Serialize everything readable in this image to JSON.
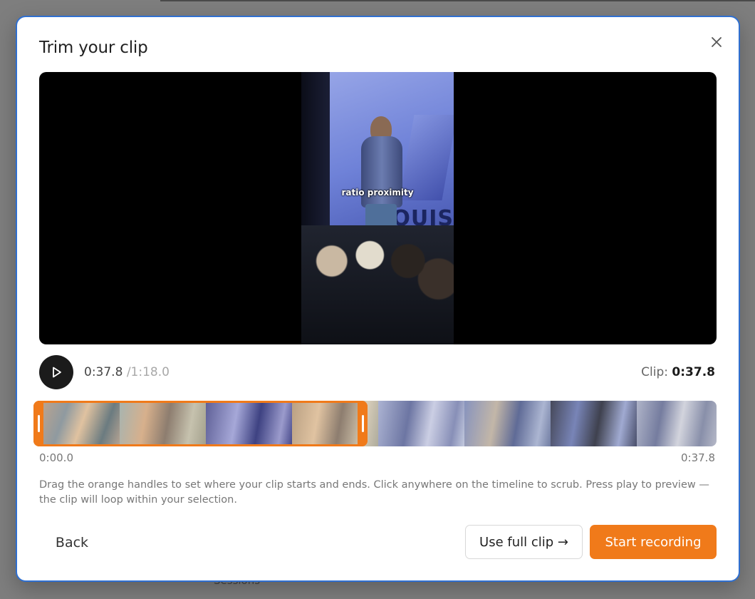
{
  "backdrop": {
    "footer_text": "Sessions"
  },
  "modal": {
    "title": "Trim your clip",
    "close_icon": "close-icon"
  },
  "video": {
    "caption": "ratio proximity",
    "banner_text": "QUIS"
  },
  "player": {
    "current_time": "0:37.8",
    "separator": "/",
    "duration": "1:18.0",
    "clip_label": "Clip:",
    "clip_length": "0:37.8",
    "play_icon": "play-icon"
  },
  "timeline": {
    "start_label": "0:00.0",
    "end_label": "0:37.8",
    "selection_start_fraction": 0.0,
    "selection_end_fraction": 0.485
  },
  "hint": "Drag the orange handles to set where your clip starts and ends. Click anywhere on the timeline to scrub. Press play to preview — the clip will loop within your selection.",
  "buttons": {
    "back": "Back",
    "use_full_clip": "Use full clip →",
    "start_recording": "Start recording"
  },
  "colors": {
    "accent": "#f07a1a",
    "modal_border": "#2f6fd0"
  }
}
